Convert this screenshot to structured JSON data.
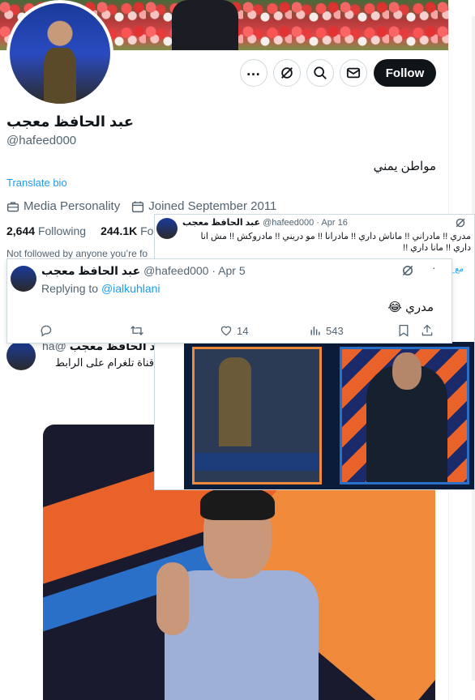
{
  "profile": {
    "display_name": "عبد الحافظ معجب",
    "handle": "@hafeed000",
    "translate_label": "Translate bio",
    "bio": "مواطن يمني",
    "category": "Media Personality",
    "joined": "Joined September 2011",
    "following_count": "2,644",
    "following_label": "Following",
    "followers_count": "244.1K",
    "followers_label": "Foll",
    "not_followed_text": "Not followed by anyone you’re fo",
    "follow_button": "Follow"
  },
  "reply_tweet": {
    "name": "عبد الحافظ معجب",
    "handle_time": "@hafeed000 · Apr 5",
    "replying_prefix": "Replying to",
    "replying_to": "@ialkuhlani",
    "text": "مدري 😂",
    "replies": "",
    "reposts": "",
    "likes": "14",
    "views": "543"
  },
  "quoted_tweet": {
    "name": "عبد الحافظ معجب",
    "handle_time": "@hafeed000 · Apr 16",
    "text": "مدري !! مادراني !! ماناش داري !! مادرانا !! مو دريني !! مادروكش !! مش انا داري !! مانا داري !!",
    "hashtag": "مع_مع"
  },
  "back_tweet": {
    "name": "عبد الحافظ معجب",
    "handle": "@ha",
    "text": "قناة تلغرام على الرابط"
  },
  "icons": {
    "more": "more-icon",
    "grok": "grok-icon",
    "search": "search-icon",
    "message": "message-icon"
  },
  "colors": {
    "accent": "#1d9bf0",
    "follow_bg": "#0f1419"
  }
}
